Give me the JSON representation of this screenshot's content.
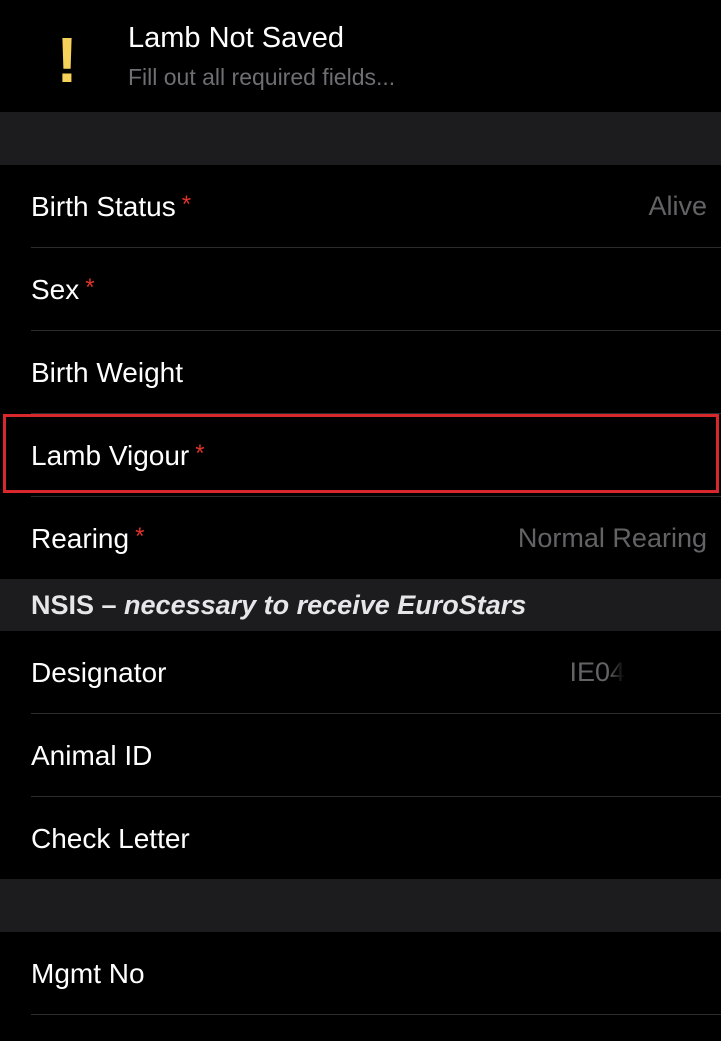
{
  "banner": {
    "icon": "exclamation-icon",
    "icon_glyph": "!",
    "icon_color": "#f7d25b",
    "title": "Lamb Not Saved",
    "subtitle": "Fill out all required fields..."
  },
  "required_marker": "*",
  "required_color": "#e0332d",
  "form": {
    "birth_status": {
      "label": "Birth Status",
      "value": "Alive"
    },
    "sex": {
      "label": "Sex",
      "value": ""
    },
    "birth_weight": {
      "label": "Birth Weight",
      "value": ""
    },
    "lamb_vigour": {
      "label": "Lamb Vigour",
      "value": ""
    },
    "rearing": {
      "label": "Rearing",
      "value": "Normal Rearing"
    }
  },
  "nsis": {
    "header_bold": "NSIS – ",
    "header_italic": "necessary to receive EuroStars",
    "designator": {
      "label": "Designator",
      "value": "IE04"
    },
    "animal_id": {
      "label": "Animal ID",
      "value": ""
    },
    "check_letter": {
      "label": "Check Letter",
      "value": ""
    }
  },
  "mgmt": {
    "mgmt_no": {
      "label": "Mgmt No",
      "value": ""
    }
  },
  "highlight_color": "#d9272e"
}
